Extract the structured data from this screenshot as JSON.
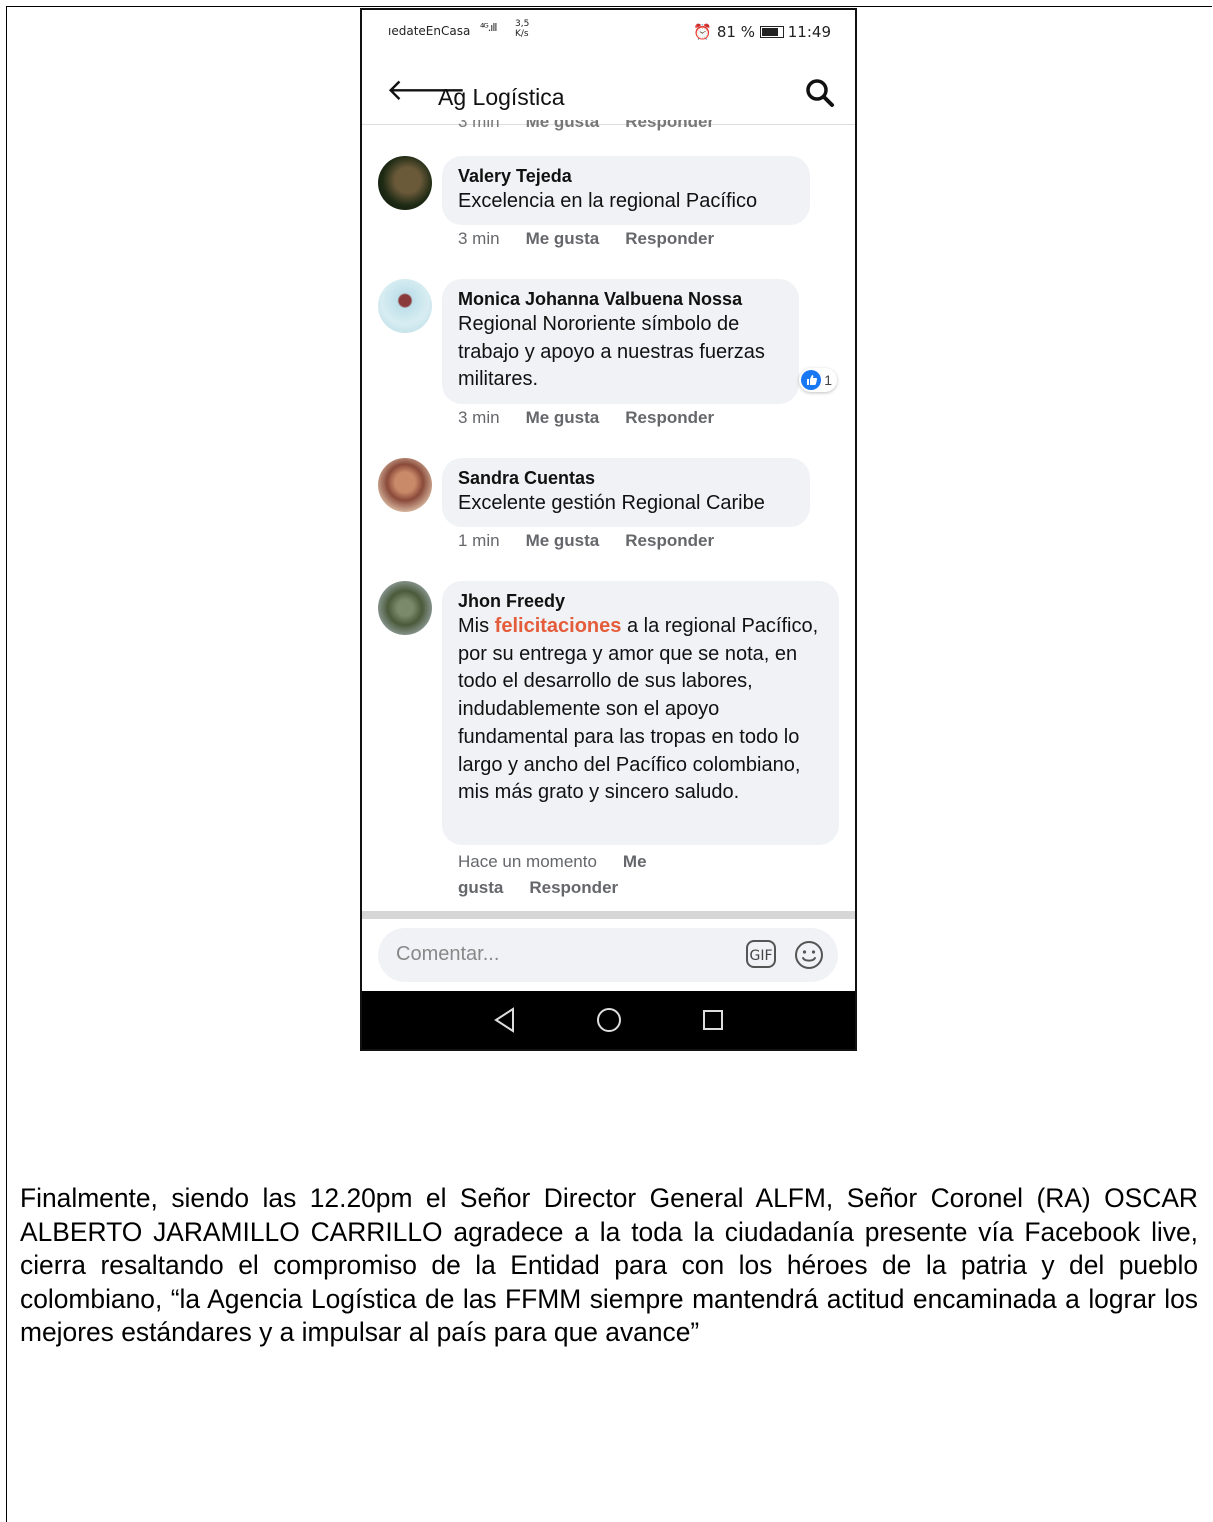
{
  "status_bar": {
    "carrier": "ıedateEnCasa",
    "signal": "⁴ᴳ.ıll",
    "speed_value": "3,5",
    "speed_unit": "K/s",
    "battery": "81 %",
    "time": "11:49"
  },
  "app_bar": {
    "title": "Ag Logística"
  },
  "comments": [
    {
      "author": "Valery Tejeda",
      "text": "Excelencia en la regional Pacífico",
      "time": "3 min",
      "like": "Me gusta",
      "reply": "Responder"
    },
    {
      "author": "Monica Johanna Valbuena Nossa",
      "text": "Regional Nororiente símbolo de trabajo y apoyo a nuestras fuerzas militares.",
      "time": "3 min",
      "like": "Me gusta",
      "reply": "Responder",
      "reactions": "1"
    },
    {
      "author": "Sandra Cuentas",
      "text": "Excelente gestión Regional Caribe",
      "time": "1 min",
      "like": "Me gusta",
      "reply": "Responder"
    },
    {
      "author": "Jhon Freedy",
      "text_before": "Mis ",
      "text_highlight": "felicitaciones",
      "text_after": " a la regional Pacífico, por su entrega y amor que se nota, en todo el desarrollo de sus labores, indudablemente son el apoyo fundamental para las tropas en todo lo largo y ancho del Pacífico colombiano, mis más grato y sincero saludo.",
      "time": "Hace un momento",
      "like": "Me gusta",
      "reply": "Responder"
    }
  ],
  "composer": {
    "placeholder": "Comentar...",
    "gif_label": "GIF"
  },
  "document": {
    "paragraph": "Finalmente, siendo las 12.20pm el Señor Director General  ALFM, Señor  Coronel (RA) OSCAR ALBERTO JARAMILLO CARRILLO agradece a la toda la ciudadanía presente vía Facebook live, cierra resaltando el compromiso de la Entidad para con los héroes de la patria y del pueblo colombiano, “la Agencia Logística de las FFMM siempre mantendrá actitud encaminada a lograr los mejores estándares y a impulsar al país para que avance”"
  },
  "colors": {
    "accent_highlight": "#e45c3a",
    "like_blue": "#1877f2",
    "bubble_bg": "#f0f2f5"
  }
}
